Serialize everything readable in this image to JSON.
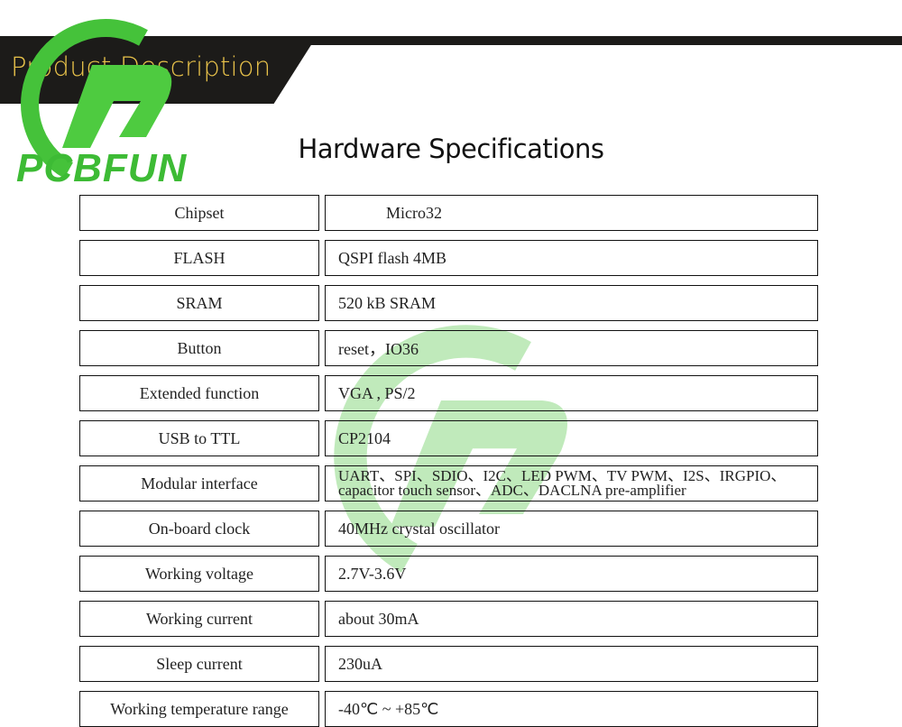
{
  "banner": {
    "title": "Product Description"
  },
  "logo": {
    "brand": "PCBFUN",
    "icon": "pcbfun-logo-icon",
    "brand_color": "#3dbb35"
  },
  "heading": "Hardware Specifications",
  "specs": [
    {
      "label": "Chipset",
      "value": "Micro32"
    },
    {
      "label": "FLASH",
      "value": "QSPI flash 4MB"
    },
    {
      "label": "SRAM",
      "value": "520 kB SRAM"
    },
    {
      "label": "Button",
      "value": "reset，IO36"
    },
    {
      "label": "Extended function",
      "value": "VGA , PS/2"
    },
    {
      "label": "USB to TTL",
      "value": "CP2104"
    },
    {
      "label": "Modular interface",
      "value_line1": "UART、SPI、SDIO、I2C、LED PWM、TV PWM、I2S、IRGPIO、",
      "value_line2": "capacitor touch sensor、ADC、DACLNA  pre-amplifier"
    },
    {
      "label": "On-board clock",
      "value": "40MHz crystal oscillator"
    },
    {
      "label": "Working voltage",
      "value": "2.7V-3.6V"
    },
    {
      "label": "Working current",
      "value": "about 30mA"
    },
    {
      "label": "Sleep current",
      "value": "230uA"
    },
    {
      "label": "Working temperature range",
      "value": "-40℃ ~ +85℃"
    }
  ],
  "colors": {
    "banner_bg": "#1c1b19",
    "banner_text": "#e8c24a",
    "logo_green": "#3dbb35"
  }
}
